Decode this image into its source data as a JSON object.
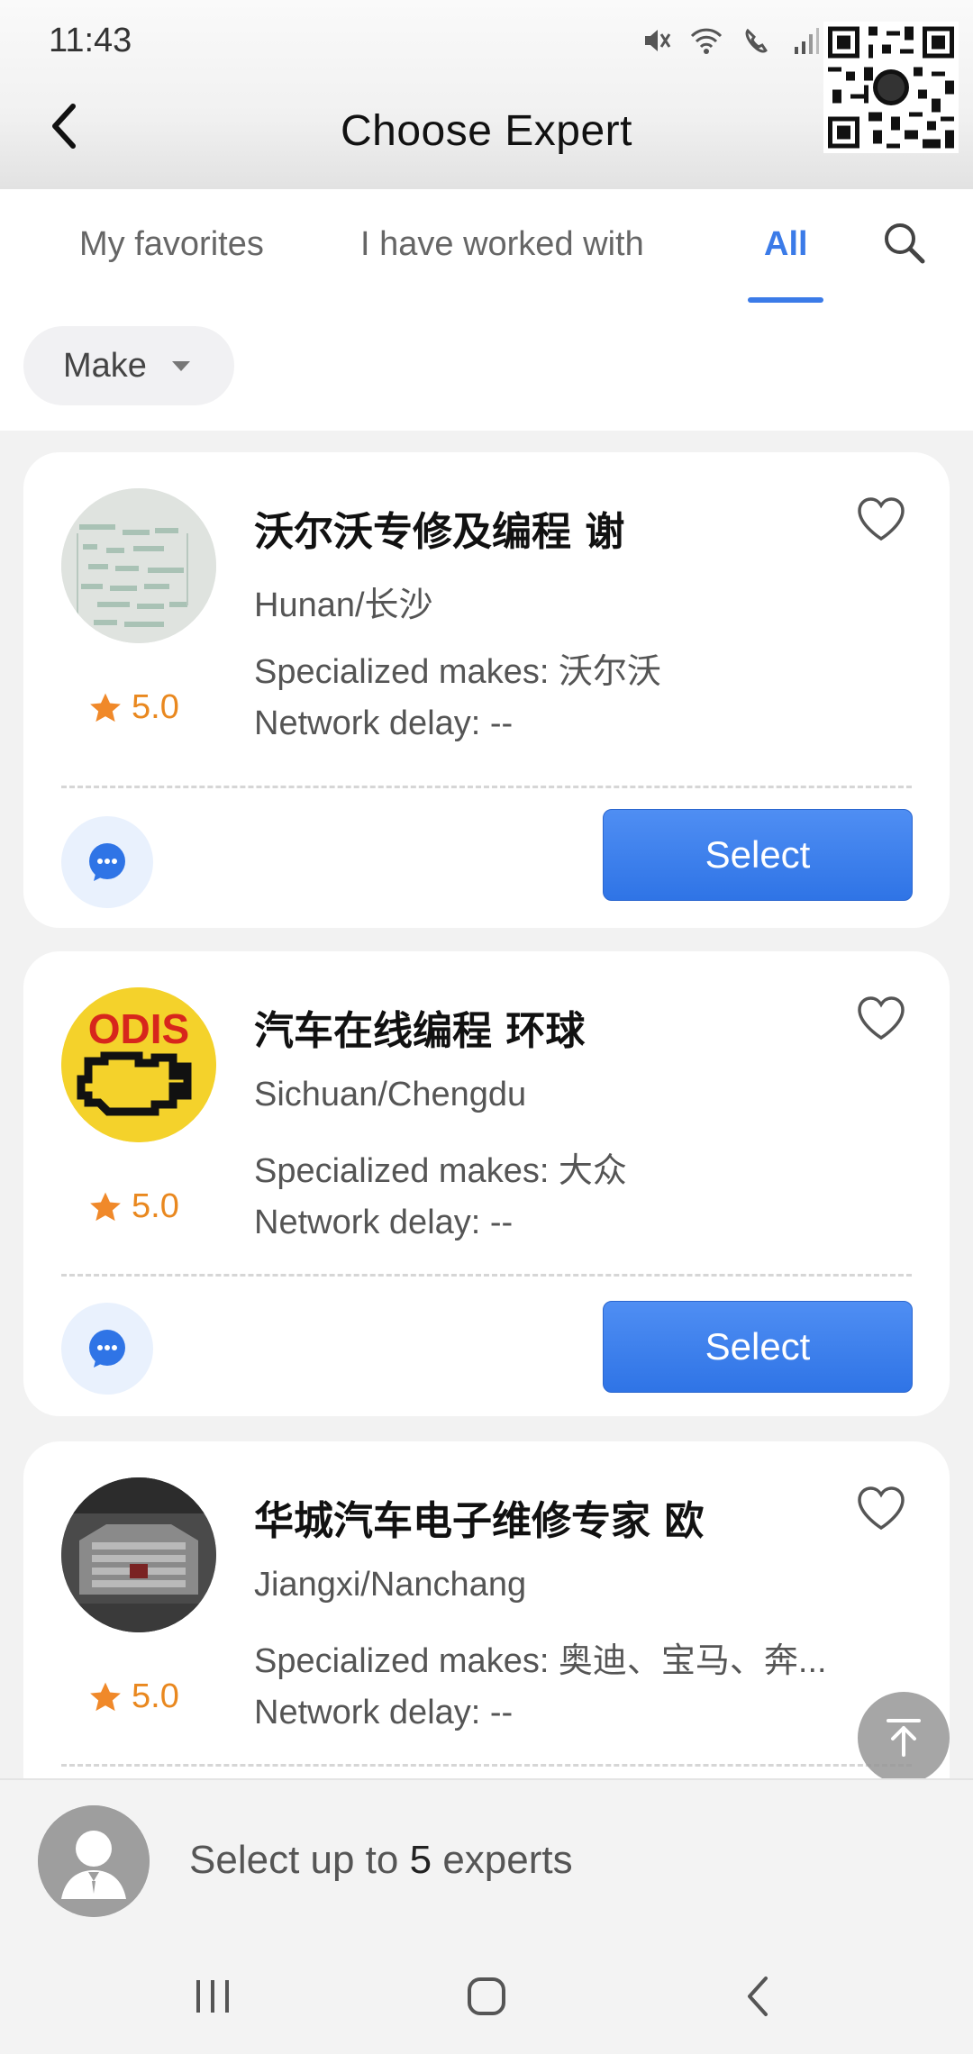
{
  "status_bar": {
    "time": "11:43"
  },
  "header": {
    "title": "Choose Expert"
  },
  "tabs": [
    {
      "label": "My favorites",
      "active": false
    },
    {
      "label": "I have worked with",
      "active": false
    },
    {
      "label": "All",
      "active": true
    }
  ],
  "filter": {
    "make_label": "Make"
  },
  "experts": [
    {
      "name": "沃尔沃专修及编程 谢",
      "region": "Hunan/长沙",
      "makes": "Specialized makes: 沃尔沃",
      "delay": "Network delay: --",
      "rating": "5.0",
      "select_label": "Select"
    },
    {
      "name": "汽车在线编程 环球",
      "region": "Sichuan/Chengdu",
      "makes": "Specialized makes: 大众",
      "delay": "Network delay: --",
      "rating": "5.0",
      "select_label": "Select",
      "avatar_text": "ODIS"
    },
    {
      "name": "华城汽车电子维修专家 欧",
      "region": "Jiangxi/Nanchang",
      "makes": "Specialized makes: 奥迪、宝马、奔...",
      "delay": "Network delay: --",
      "rating": "5.0"
    }
  ],
  "bottom": {
    "prefix": "Select up to ",
    "count": "5",
    "suffix": " experts"
  },
  "colors": {
    "accent": "#3b7be8",
    "star": "#f0892a"
  }
}
